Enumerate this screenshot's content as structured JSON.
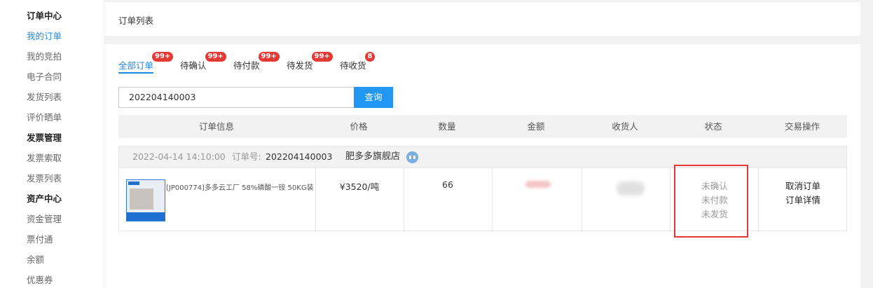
{
  "sidebar": {
    "items": [
      {
        "label": "订单中心",
        "type": "section"
      },
      {
        "label": "我的订单",
        "type": "active"
      },
      {
        "label": "我的竞拍",
        "type": "link"
      },
      {
        "label": "电子合同",
        "type": "link"
      },
      {
        "label": "发货列表",
        "type": "link"
      },
      {
        "label": "评价晒单",
        "type": "link"
      },
      {
        "label": "发票管理",
        "type": "section"
      },
      {
        "label": "发票索取",
        "type": "link"
      },
      {
        "label": "发票列表",
        "type": "link"
      },
      {
        "label": "资产中心",
        "type": "section"
      },
      {
        "label": "资金管理",
        "type": "link"
      },
      {
        "label": "票付通",
        "type": "link"
      },
      {
        "label": "余额",
        "type": "link"
      },
      {
        "label": "优惠券",
        "type": "link"
      }
    ]
  },
  "page": {
    "title": "订单列表"
  },
  "tabs": [
    {
      "label": "全部订单",
      "badge": "99+",
      "active": true
    },
    {
      "label": "待确认",
      "badge": "99+"
    },
    {
      "label": "待付款",
      "badge": "99+"
    },
    {
      "label": "待发货",
      "badge": "99+"
    },
    {
      "label": "待收货",
      "badge": "8"
    }
  ],
  "search": {
    "value": "202204140003",
    "button_label": "查询"
  },
  "table": {
    "headers": [
      "订单信息",
      "价格",
      "数量",
      "金额",
      "收货人",
      "状态",
      "交易操作"
    ]
  },
  "order": {
    "date": "2022-04-14 14:10:00",
    "order_no_label": "订单号:",
    "order_no": "202204140003",
    "shop": "肥多多旗舰店",
    "product_name": "[JP000774]多多云工厂 58%磷酸一铵 50KG装",
    "price": "¥3520/吨",
    "quantity": "66",
    "status": [
      "未确认",
      "未付款",
      "未发货"
    ],
    "actions": [
      "取消订单",
      "订单详情"
    ]
  },
  "colors": {
    "accent": "#1e88e5",
    "badge": "#e53935",
    "highlight_box": "#e53935"
  }
}
